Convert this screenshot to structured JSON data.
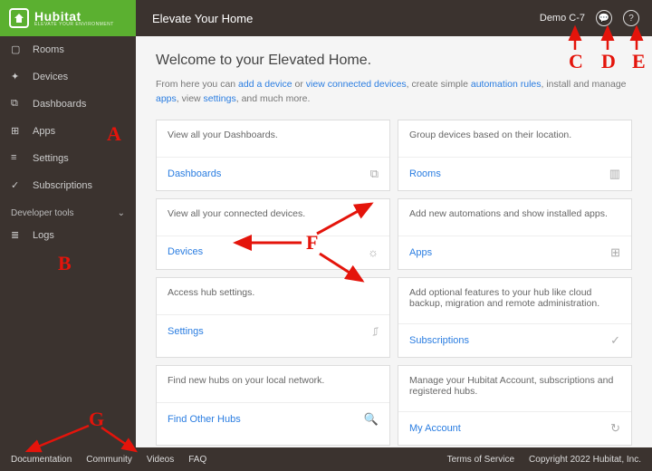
{
  "brand": {
    "name": "Hubitat",
    "tagline": "ELEVATE YOUR ENVIRONMENT"
  },
  "header": {
    "title": "Elevate Your Home",
    "hub_name": "Demo C-7"
  },
  "sidebar": {
    "items": [
      {
        "label": "Rooms"
      },
      {
        "label": "Devices"
      },
      {
        "label": "Dashboards"
      },
      {
        "label": "Apps"
      },
      {
        "label": "Settings"
      },
      {
        "label": "Subscriptions"
      }
    ],
    "dev_section": "Developer tools",
    "dev_items": [
      {
        "label": "Logs"
      }
    ]
  },
  "main": {
    "welcome": "Welcome to your Elevated Home.",
    "intro_pre": "From here you can ",
    "intro_add": "add a device",
    "intro_or": " or ",
    "intro_view": "view connected devices",
    "intro_mid1": ", create simple ",
    "intro_rules": "automation rules",
    "intro_mid2": ", install and manage ",
    "intro_apps": "apps",
    "intro_mid3": ", view ",
    "intro_settings": "settings",
    "intro_end": ", and much more.",
    "cards": [
      {
        "desc": "View all your Dashboards.",
        "link": "Dashboards",
        "icon": "⧉"
      },
      {
        "desc": "Group devices based on their location.",
        "link": "Rooms",
        "icon": "▥"
      },
      {
        "desc": "View all your connected devices.",
        "link": "Devices",
        "icon": "☼"
      },
      {
        "desc": "Add new automations and show installed apps.",
        "link": "Apps",
        "icon": "⊞"
      },
      {
        "desc": "Access hub settings.",
        "link": "Settings",
        "icon": "⎎"
      },
      {
        "desc": "Add optional features to your hub like cloud backup, migration and remote administration.",
        "link": "Subscriptions",
        "icon": "✓"
      },
      {
        "desc": "Find new hubs on your local network.",
        "link": "Find Other Hubs",
        "icon": "🔍"
      },
      {
        "desc": "Manage your Hubitat Account, subscriptions and registered hubs.",
        "link": "My Account",
        "icon": "↻"
      }
    ]
  },
  "footer": {
    "left": [
      "Documentation",
      "Community",
      "Videos",
      "FAQ"
    ],
    "tos": "Terms of Service",
    "copyright": "Copyright 2022 Hubitat, Inc."
  },
  "annotations": {
    "A": "A",
    "B": "B",
    "C": "C",
    "D": "D",
    "E": "E",
    "F": "F",
    "G": "G"
  }
}
